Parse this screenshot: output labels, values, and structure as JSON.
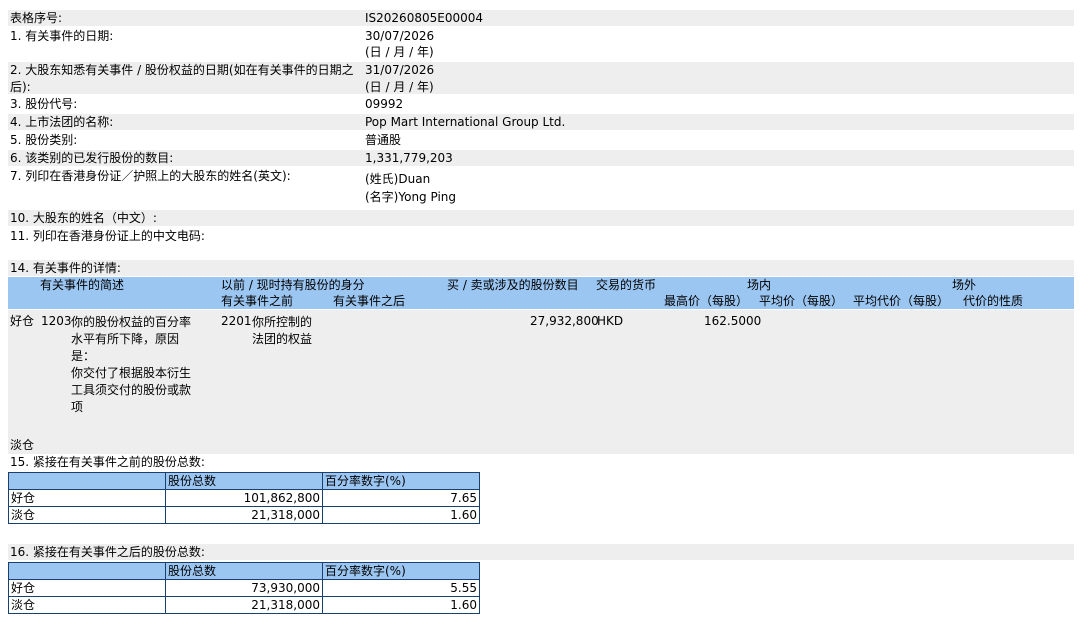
{
  "form": {
    "serial_label": "表格序号:",
    "serial_value": "IS20260805E00004",
    "f1_label": "1. 有关事件的日期:",
    "f1_value": "30/07/2026",
    "f1_hint": "(日 / 月 / 年)",
    "f2_label_line1": "2. 大股东知悉有关事件 / 股份权益的日期(如在有关事件的日期之",
    "f2_label_line2": "后):",
    "f2_value": "31/07/2026",
    "f2_hint": "(日 / 月 / 年)",
    "f3_label": "3. 股份代号:",
    "f3_value": "09992",
    "f4_label": "4. 上市法团的名称:",
    "f4_value": "Pop Mart International Group Ltd.",
    "f5_label": "5. 股份类别:",
    "f5_value": "普通股",
    "f6_label": "6. 该类别的已发行股份的数目:",
    "f6_value": "1,331,779,203",
    "f7_label": "7. 列印在香港身份证／护照上的大股东的姓名(英文):",
    "f7_surname": "(姓氏)Duan",
    "f7_given": "(名字)Yong Ping",
    "f10_label": "10. 大股东的姓名（中文）:",
    "f11_label": "11. 列印在香港身份证上的中文电码:"
  },
  "section14": {
    "title": "14. 有关事件的详情:",
    "headers": {
      "event_desc": "有关事件的简述",
      "capacity": "以前 / 现时持有股份的身分",
      "before": "有关事件之前",
      "after": "有关事件之后",
      "shares_involved": "买 / 卖或涉及的股份数目",
      "currency": "交易的货币",
      "on_exchange": "场内",
      "high_price": "最高价（每股）",
      "avg_price": "平均价（每股）",
      "off_exchange": "场外",
      "avg_consideration": "平均代价（每股）",
      "nature": "代价的性质"
    },
    "long_row": {
      "position": "好仓",
      "event_code": "1203",
      "event_lines": [
        "你的股份权益的百分率",
        "水平有所下降，原因",
        "是：",
        "你交付了根据股本衍生",
        "工具须交付的股份或款",
        "项"
      ],
      "capacity_code": "2201",
      "capacity_lines": [
        "你所控制的",
        "法团的权益"
      ],
      "shares": "27,932,800",
      "currency": "HKD",
      "high_price": "162.5000"
    },
    "short_label": "淡仓"
  },
  "section15": {
    "title": "15. 紧接在有关事件之前的股份总数:",
    "col_shares": "股份总数",
    "col_percent": "百分率数字(%)",
    "rows": [
      {
        "label": "好仓",
        "shares": "101,862,800",
        "percent": "7.65"
      },
      {
        "label": "淡仓",
        "shares": "21,318,000",
        "percent": "1.60"
      }
    ]
  },
  "section16": {
    "title": "16. 紧接在有关事件之后的股份总数:",
    "col_shares": "股份总数",
    "col_percent": "百分率数字(%)",
    "rows": [
      {
        "label": "好仓",
        "shares": "73,930,000",
        "percent": "5.55"
      },
      {
        "label": "淡仓",
        "shares": "21,318,000",
        "percent": "1.60"
      }
    ]
  }
}
